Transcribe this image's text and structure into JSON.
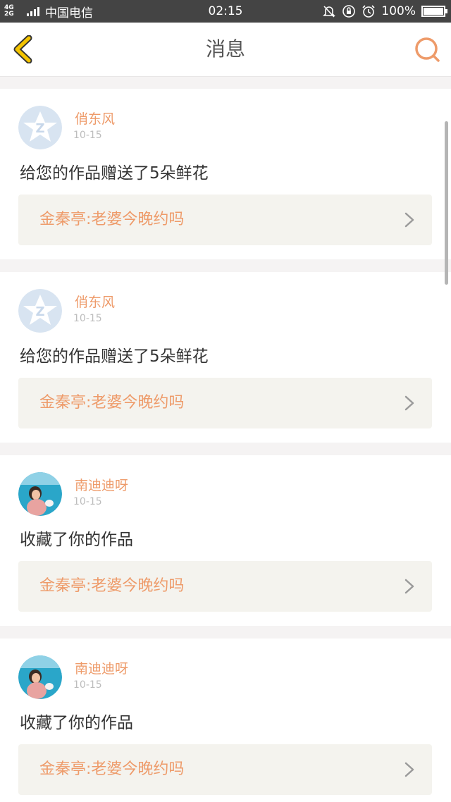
{
  "status_bar": {
    "signal_line1": "4G",
    "signal_line2": "2G",
    "carrier": "中国电信",
    "time": "02:15",
    "battery_percent": "100%"
  },
  "header": {
    "title": "消息",
    "back_icon": "chevron-left-icon",
    "search_icon": "search-icon"
  },
  "colors": {
    "accent": "#ee9b6a",
    "back_arrow": "#f4c400",
    "quote_bg": "#f4f3ee"
  },
  "messages": [
    {
      "username": "俏东风",
      "time": "10-15",
      "action": "给您的作品赠送了5朵鲜花",
      "quote": "金秦亭:老婆今晚约吗",
      "avatar": "qq-default-avatar"
    },
    {
      "username": "俏东风",
      "time": "10-15",
      "action": "给您的作品赠送了5朵鲜花",
      "quote": "金秦亭:老婆今晚约吗",
      "avatar": "qq-default-avatar"
    },
    {
      "username": "南迪迪呀",
      "time": "10-15",
      "action": "收藏了你的作品",
      "quote": "金秦亭:老婆今晚约吗",
      "avatar": "photo-avatar"
    },
    {
      "username": "南迪迪呀",
      "time": "10-15",
      "action": "收藏了你的作品",
      "quote": "金秦亭:老婆今晚约吗",
      "avatar": "photo-avatar"
    }
  ]
}
